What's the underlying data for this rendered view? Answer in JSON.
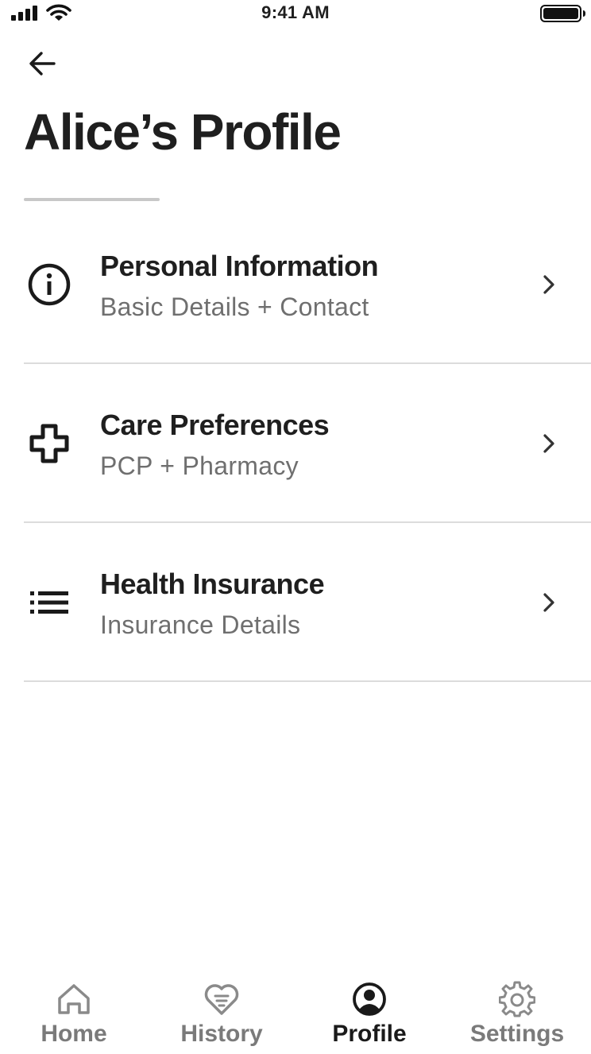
{
  "status_bar": {
    "time": "9:41 AM"
  },
  "header": {
    "title": "Alice’s Profile"
  },
  "menu": [
    {
      "label": "Personal Information",
      "subtitle": "Basic Details + Contact",
      "icon": "info-icon"
    },
    {
      "label": "Care Preferences",
      "subtitle": "PCP + Pharmacy",
      "icon": "medical-cross-icon"
    },
    {
      "label": "Health Insurance",
      "subtitle": "Insurance Details",
      "icon": "list-icon"
    }
  ],
  "tab_bar": {
    "active": "Profile",
    "tabs": [
      {
        "label": "Home",
        "icon": "home-icon"
      },
      {
        "label": "History",
        "icon": "heart-list-icon"
      },
      {
        "label": "Profile",
        "icon": "profile-icon"
      },
      {
        "label": "Settings",
        "icon": "gear-icon"
      }
    ]
  },
  "colors": {
    "text": "#1f1f1f",
    "subtext": "#6f6f6f",
    "inactive_tab": "#7a7a7a",
    "divider": "#dcdcdc"
  }
}
